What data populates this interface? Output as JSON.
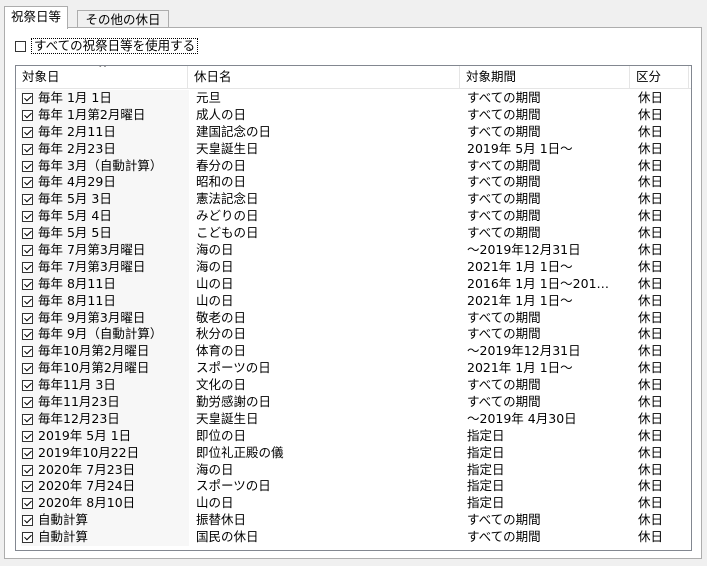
{
  "tabs": [
    {
      "label": "祝祭日等",
      "active": true
    },
    {
      "label": "その他の休日",
      "active": false
    }
  ],
  "use_all": {
    "label": "すべての祝祭日等を使用する",
    "checked": false
  },
  "columns": [
    "対象日",
    "休日名",
    "対象期間",
    "区分"
  ],
  "sort_indicator": "^",
  "rows": [
    {
      "checked": true,
      "date": "毎年 1月 1日",
      "name": "元旦",
      "period": "すべての期間",
      "kind": "休日"
    },
    {
      "checked": true,
      "date": "毎年 1月第2月曜日",
      "name": "成人の日",
      "period": "すべての期間",
      "kind": "休日"
    },
    {
      "checked": true,
      "date": "毎年 2月11日",
      "name": "建国記念の日",
      "period": "すべての期間",
      "kind": "休日"
    },
    {
      "checked": true,
      "date": "毎年 2月23日",
      "name": "天皇誕生日",
      "period": "2019年 5月 1日～",
      "kind": "休日"
    },
    {
      "checked": true,
      "date": "毎年 3月（自動計算）",
      "name": "春分の日",
      "period": "すべての期間",
      "kind": "休日"
    },
    {
      "checked": true,
      "date": "毎年 4月29日",
      "name": "昭和の日",
      "period": "すべての期間",
      "kind": "休日"
    },
    {
      "checked": true,
      "date": "毎年 5月 3日",
      "name": "憲法記念日",
      "period": "すべての期間",
      "kind": "休日"
    },
    {
      "checked": true,
      "date": "毎年 5月 4日",
      "name": "みどりの日",
      "period": "すべての期間",
      "kind": "休日"
    },
    {
      "checked": true,
      "date": "毎年 5月 5日",
      "name": "こどもの日",
      "period": "すべての期間",
      "kind": "休日"
    },
    {
      "checked": true,
      "date": "毎年 7月第3月曜日",
      "name": "海の日",
      "period": "～2019年12月31日",
      "kind": "休日"
    },
    {
      "checked": true,
      "date": "毎年 7月第3月曜日",
      "name": "海の日",
      "period": "2021年 1月 1日～",
      "kind": "休日"
    },
    {
      "checked": true,
      "date": "毎年 8月11日",
      "name": "山の日",
      "period": "2016年 1月 1日～201…",
      "kind": "休日"
    },
    {
      "checked": true,
      "date": "毎年 8月11日",
      "name": "山の日",
      "period": "2021年 1月 1日～",
      "kind": "休日"
    },
    {
      "checked": true,
      "date": "毎年 9月第3月曜日",
      "name": "敬老の日",
      "period": "すべての期間",
      "kind": "休日"
    },
    {
      "checked": true,
      "date": "毎年 9月（自動計算）",
      "name": "秋分の日",
      "period": "すべての期間",
      "kind": "休日"
    },
    {
      "checked": true,
      "date": "毎年10月第2月曜日",
      "name": "体育の日",
      "period": "～2019年12月31日",
      "kind": "休日"
    },
    {
      "checked": true,
      "date": "毎年10月第2月曜日",
      "name": "スポーツの日",
      "period": "2021年 1月 1日～",
      "kind": "休日"
    },
    {
      "checked": true,
      "date": "毎年11月 3日",
      "name": "文化の日",
      "period": "すべての期間",
      "kind": "休日"
    },
    {
      "checked": true,
      "date": "毎年11月23日",
      "name": "勤労感謝の日",
      "period": "すべての期間",
      "kind": "休日"
    },
    {
      "checked": true,
      "date": "毎年12月23日",
      "name": "天皇誕生日",
      "period": "～2019年 4月30日",
      "kind": "休日"
    },
    {
      "checked": true,
      "date": "2019年 5月 1日",
      "name": "即位の日",
      "period": "指定日",
      "kind": "休日"
    },
    {
      "checked": true,
      "date": "2019年10月22日",
      "name": "即位礼正殿の儀",
      "period": "指定日",
      "kind": "休日"
    },
    {
      "checked": true,
      "date": "2020年 7月23日",
      "name": "海の日",
      "period": "指定日",
      "kind": "休日"
    },
    {
      "checked": true,
      "date": "2020年 7月24日",
      "name": "スポーツの日",
      "period": "指定日",
      "kind": "休日"
    },
    {
      "checked": true,
      "date": "2020年 8月10日",
      "name": "山の日",
      "period": "指定日",
      "kind": "休日"
    },
    {
      "checked": true,
      "date": "自動計算",
      "name": "振替休日",
      "period": "すべての期間",
      "kind": "休日"
    },
    {
      "checked": true,
      "date": "自動計算",
      "name": "国民の休日",
      "period": "すべての期間",
      "kind": "休日"
    }
  ]
}
